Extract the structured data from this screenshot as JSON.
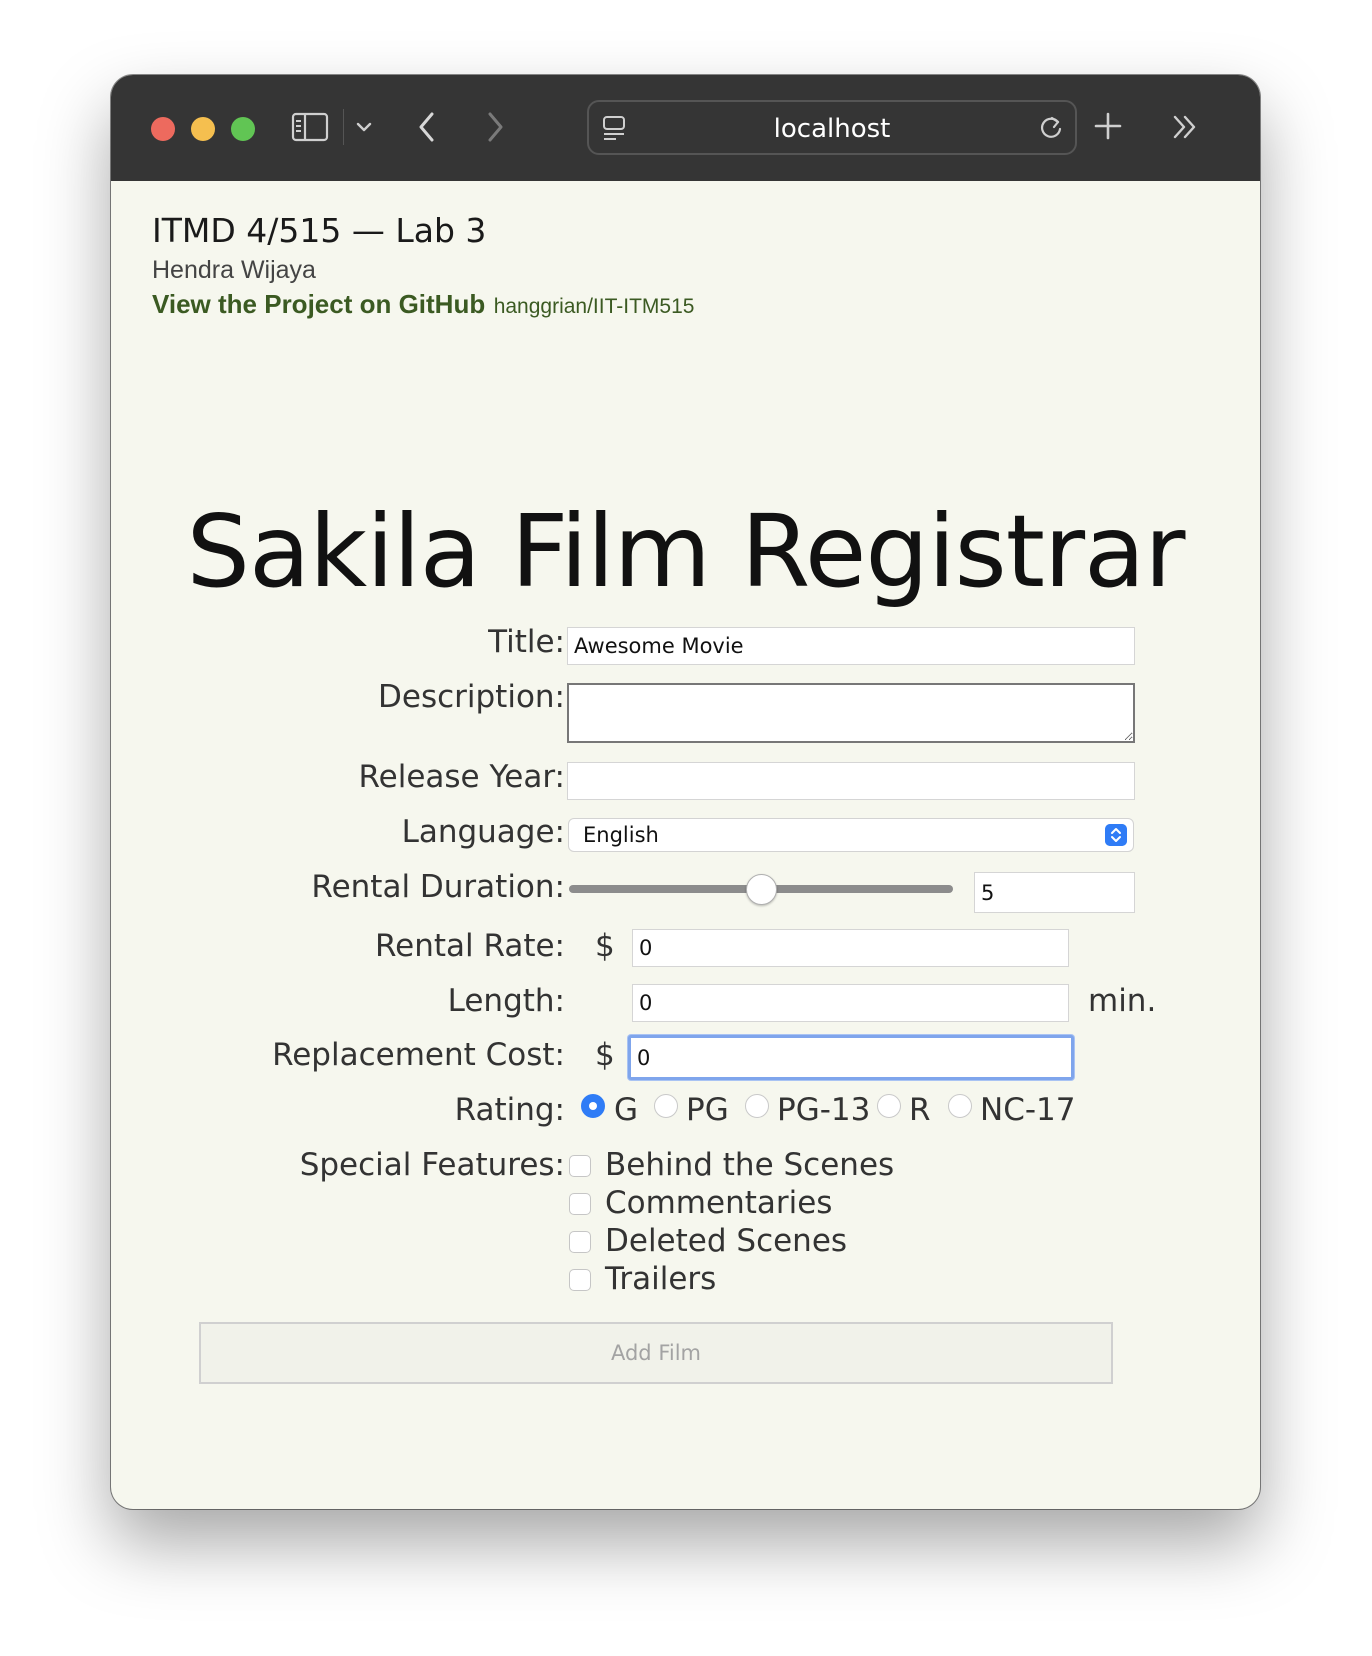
{
  "browser": {
    "url": "localhost"
  },
  "header": {
    "course_title": "ITMD 4/515 — Lab 3",
    "author": "Hendra Wijaya",
    "github_link": "View the Project on GitHub",
    "github_repo": "hanggrian/IIT-ITM515"
  },
  "form": {
    "heading": "Sakila Film Registrar",
    "title": {
      "label": "Title:",
      "value": "Awesome Movie"
    },
    "description": {
      "label": "Description:",
      "value": ""
    },
    "release_year": {
      "label": "Release Year:",
      "value": ""
    },
    "language": {
      "label": "Language:",
      "selected": "English"
    },
    "rental_duration": {
      "label": "Rental Duration:",
      "value": "5",
      "slider_fraction": 0.5
    },
    "rental_rate": {
      "label": "Rental Rate:",
      "prefix": "$",
      "value": "0"
    },
    "length": {
      "label": "Length:",
      "value": "0",
      "suffix": "min."
    },
    "replacement_cost": {
      "label": "Replacement Cost:",
      "prefix": "$",
      "value": "0"
    },
    "rating": {
      "label": "Rating:",
      "options": [
        "G",
        "PG",
        "PG-13",
        "R",
        "NC-17"
      ],
      "selected": "G"
    },
    "special_features": {
      "label": "Special Features:",
      "options": [
        "Behind the Scenes",
        "Commentaries",
        "Deleted Scenes",
        "Trailers"
      ]
    },
    "submit_label": "Add Film"
  },
  "colors": {
    "page_bg": "#f6f7ee",
    "link": "#3b5a22",
    "accent": "#2f7cf6",
    "titlebar": "#353535"
  }
}
